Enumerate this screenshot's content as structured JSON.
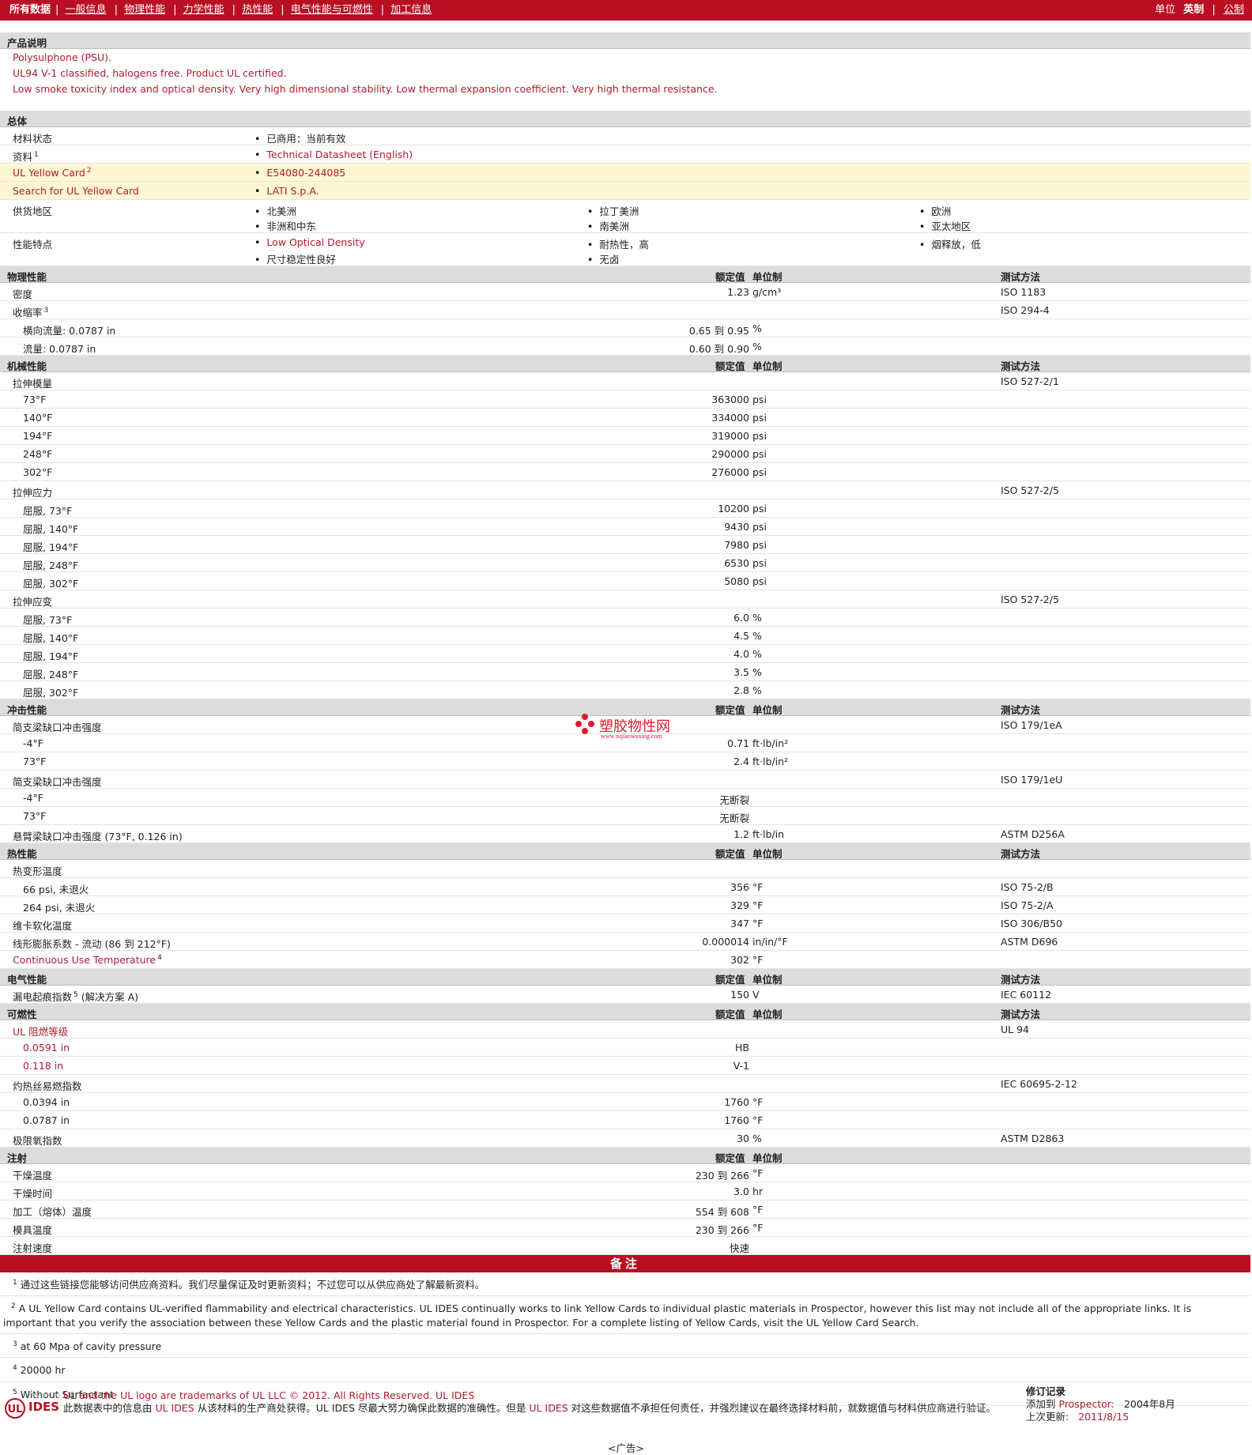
{
  "nav": {
    "all_data": "所有数据",
    "tabs": [
      "一般信息",
      "物理性能",
      "力学性能",
      "热性能",
      "电气性能与可燃性",
      "加工信息"
    ],
    "units_label": "单位",
    "unit_english": "英制",
    "unit_metric": "公制"
  },
  "headers": {
    "value": "额定值",
    "unit": "单位制",
    "test": "测试方法"
  },
  "product": {
    "title": "产品说明",
    "lines": [
      "Polysulphone (PSU).",
      "UL94 V-1 classified, halogens free. Product UL certified.",
      "Low smoke toxicity index and optical density. Very high dimensional stability. Low thermal expansion coefficient. Very high thermal resistance."
    ]
  },
  "general": {
    "title": "总体",
    "material_status_label": "材料状态",
    "material_status_value": "已商用：当前有效",
    "literature_label": "资料",
    "literature_sup": "1",
    "literature_value": "Technical Datasheet (English)",
    "ul_card_label": "UL Yellow Card",
    "ul_card_sup": "2",
    "ul_card_value": "E54080-244085",
    "search_label": "Search for UL Yellow Card",
    "search_value": "LATI S.p.A.",
    "regions_label": "供货地区",
    "regions": [
      "北美洲",
      "拉丁美洲",
      "欧洲",
      "非洲和中东",
      "南美洲",
      "亚太地区"
    ],
    "features_label": "性能特点",
    "features": [
      "Low Optical Density",
      "耐热性，高",
      "烟释放，低",
      "尺寸稳定性良好",
      "无卤"
    ]
  },
  "physical": {
    "title": "物理性能",
    "density_label": "密度",
    "density_value": "1.23",
    "density_unit": "g/cm³",
    "density_test": "ISO 1183",
    "shrink_label": "收缩率",
    "shrink_sup": "3",
    "shrink_test": "ISO 294-4",
    "shrink_rows": [
      {
        "label": "横向流量: 0.0787 in",
        "value": "0.65 到  0.95",
        "unit": "%"
      },
      {
        "label": "流量: 0.0787 in",
        "value": "0.60 到  0.90",
        "unit": "%"
      }
    ]
  },
  "mechanical": {
    "title": "机械性能",
    "modulus_label": "拉伸模量",
    "modulus_test": "ISO 527-2/1",
    "modulus_rows": [
      {
        "label": "73°F",
        "value": "363000",
        "unit": "psi"
      },
      {
        "label": "140°F",
        "value": "334000",
        "unit": "psi"
      },
      {
        "label": "194°F",
        "value": "319000",
        "unit": "psi"
      },
      {
        "label": "248°F",
        "value": "290000",
        "unit": "psi"
      },
      {
        "label": "302°F",
        "value": "276000",
        "unit": "psi"
      }
    ],
    "stress_label": "拉伸应力",
    "stress_test": "ISO 527-2/5",
    "stress_rows": [
      {
        "label": "屈服, 73°F",
        "value": "10200",
        "unit": "psi"
      },
      {
        "label": "屈服, 140°F",
        "value": "9430",
        "unit": "psi"
      },
      {
        "label": "屈服, 194°F",
        "value": "7980",
        "unit": "psi"
      },
      {
        "label": "屈服, 248°F",
        "value": "6530",
        "unit": "psi"
      },
      {
        "label": "屈服, 302°F",
        "value": "5080",
        "unit": "psi"
      }
    ],
    "strain_label": "拉伸应变",
    "strain_test": "ISO 527-2/5",
    "strain_rows": [
      {
        "label": "屈服, 73°F",
        "value": "6.0",
        "unit": "%"
      },
      {
        "label": "屈服, 140°F",
        "value": "4.5",
        "unit": "%"
      },
      {
        "label": "屈服, 194°F",
        "value": "4.0",
        "unit": "%"
      },
      {
        "label": "屈服, 248°F",
        "value": "3.5",
        "unit": "%"
      },
      {
        "label": "屈服, 302°F",
        "value": "2.8",
        "unit": "%"
      }
    ]
  },
  "impact": {
    "title": "冲击性能",
    "charpy_notched_label": "简支梁缺口冲击强度",
    "charpy_notched_test": "ISO 179/1eA",
    "charpy_notched_rows": [
      {
        "label": "-4°F",
        "value": "0.71",
        "unit": "ft·lb/in²"
      },
      {
        "label": "73°F",
        "value": "2.4",
        "unit": "ft·lb/in²"
      }
    ],
    "charpy_unnotched_label": "简支梁缺口冲击强度",
    "charpy_unnotched_test": "ISO 179/1eU",
    "charpy_unnotched_rows": [
      {
        "label": "-4°F",
        "value": "无断裂"
      },
      {
        "label": "73°F",
        "value": "无断裂"
      }
    ],
    "izod_label": "悬臂梁缺口冲击强度",
    "izod_cond": "(73°F, 0.126 in)",
    "izod_value": "1.2",
    "izod_unit": "ft·lb/in",
    "izod_test": "ASTM D256A"
  },
  "watermark": {
    "text": "塑胶物性网",
    "url": "www.sujiaowuxing.com"
  },
  "thermal": {
    "title": "热性能",
    "hdt_label": "热变形温度",
    "hdt_rows": [
      {
        "label": "66 psi, 未退火",
        "value": "356",
        "unit": "°F",
        "test": "ISO 75-2/B"
      },
      {
        "label": "264 psi, 未退火",
        "value": "329",
        "unit": "°F",
        "test": "ISO 75-2/A"
      }
    ],
    "vicat_label": "维卡软化温度",
    "vicat_value": "347",
    "vicat_unit": "°F",
    "vicat_test": "ISO 306/B50",
    "clte_label": "线形膨胀系数 - 流动",
    "clte_cond": "(86 到  212°F)",
    "clte_value": "0.000014",
    "clte_unit": "in/in/°F",
    "clte_test": "ASTM D696",
    "cut_label": "Continuous Use Temperature",
    "cut_sup": "4",
    "cut_value": "302",
    "cut_unit": "°F"
  },
  "electrical": {
    "title": "电气性能",
    "cti_label": "漏电起痕指数",
    "cti_sup": "5",
    "cti_cond": "(解决方案  A)",
    "cti_value": "150",
    "cti_unit": "V",
    "cti_test": "IEC 60112"
  },
  "flammability": {
    "title": "可燃性",
    "ul_label": "UL 阻燃等级",
    "ul_test": "UL 94",
    "ul_rows": [
      {
        "label": "0.0591 in",
        "value": "HB"
      },
      {
        "label": "0.118 in",
        "value": "V-1"
      }
    ],
    "gwfi_label": "灼热丝易燃指数",
    "gwfi_test": "IEC 60695-2-12",
    "gwfi_rows": [
      {
        "label": "0.0394 in",
        "value": "1760",
        "unit": "°F"
      },
      {
        "label": "0.0787 in",
        "value": "1760",
        "unit": "°F"
      }
    ],
    "loi_label": "极限氧指数",
    "loi_value": "30",
    "loi_unit": "%",
    "loi_test": "ASTM D2863"
  },
  "injection": {
    "title": "注射",
    "rows": [
      {
        "label": "干燥温度",
        "value": "230 到  266",
        "unit": "°F"
      },
      {
        "label": "干燥时间",
        "value": "3.0",
        "unit": "hr"
      },
      {
        "label": "加工（熔体）温度",
        "value": "554 到  608",
        "unit": "°F"
      },
      {
        "label": "模具温度",
        "value": "230 到  266",
        "unit": "°F"
      },
      {
        "label": "注射速度",
        "value": "快速",
        "unit": ""
      }
    ]
  },
  "notes": {
    "title": "备注",
    "items": [
      {
        "num": "1",
        "text": "通过这些链接您能够访问供应商资料。我们尽量保证及时更新资料；不过您可以从供应商处了解最新资料。"
      },
      {
        "num": "2",
        "text": "A UL Yellow Card contains UL-verified flammability and electrical characteristics. UL IDES continually works to link Yellow Cards to individual plastic materials in Prospector, however this list may not include all of the appropriate links. It is important that you verify the association between these Yellow Cards and the plastic material found in Prospector. For a complete listing of Yellow Cards, visit the UL Yellow Card Search."
      },
      {
        "num": "3",
        "text": "at 60 Mpa of cavity pressure"
      },
      {
        "num": "4",
        "text": "20000 hr"
      },
      {
        "num": "5",
        "text": "Without Surfactant"
      }
    ]
  },
  "footer": {
    "logo_ul": "UL",
    "logo_small": "Powered by",
    "logo_ides": "IDES",
    "trademark": "UL and the UL logo are trademarks of UL LLC © 2012. All Rights Reserved.",
    "ul_ides": "UL IDES",
    "disclaimer_1": "此数据表中的信息由",
    "disclaimer_2": "从该材料的生产商处获得。UL IDES 尽最大努力确保此数据的准确性。但是",
    "disclaimer_3": "对这些数据值不承担任何责任，并强烈建议在最终选择材料前，就数据值与材料供应商进行验证。",
    "rev_title": "修订记录",
    "rev_added_label": "添加到",
    "rev_prospector": "Prospector:",
    "rev_added_date": "2004年8月",
    "rev_updated_label": "上次更新:",
    "rev_updated_date": "2011/8/15",
    "ad": "<广告>"
  }
}
